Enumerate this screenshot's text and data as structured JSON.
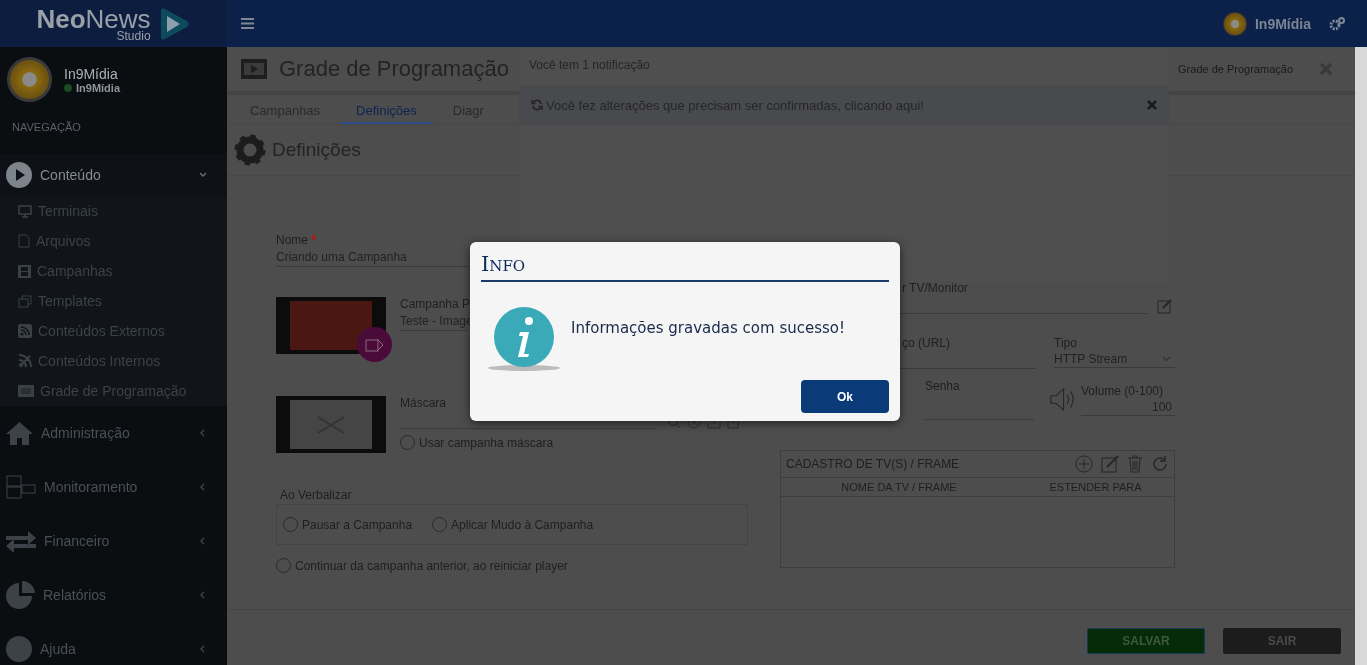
{
  "brand": {
    "name": "**Neo**News",
    "sub": "Studio"
  },
  "topbar": {
    "user": "In9Mídia"
  },
  "profile": {
    "name": "In9Mídia",
    "status": "In9Mídia",
    "online": true
  },
  "nav_header": "NAVEGAÇÃO",
  "nav": [
    {
      "label": "Conteúdo",
      "expanded": true,
      "children": [
        {
          "label": "Terminais"
        },
        {
          "label": "Arquivos"
        },
        {
          "label": "Campanhas"
        },
        {
          "label": "Templates"
        },
        {
          "label": "Conteúdos Externos"
        },
        {
          "label": "Conteúdos Internos"
        },
        {
          "label": "Grade de Programação"
        }
      ]
    },
    {
      "label": "Administração",
      "expanded": false
    },
    {
      "label": "Monitoramento",
      "expanded": false
    },
    {
      "label": "Financeiro",
      "expanded": false
    },
    {
      "label": "Relatórios",
      "expanded": false
    },
    {
      "label": "Ajuda",
      "expanded": false
    }
  ],
  "page": {
    "title": "Grade de Programação",
    "breadcrumb": "Grade de Programação",
    "section": "Definições"
  },
  "tabs": [
    {
      "label": "Campanhas",
      "selected": false
    },
    {
      "label": "Definições",
      "selected": true
    },
    {
      "label": "Diagr",
      "selected": false
    }
  ],
  "notification": {
    "header": "Você tem 1 notificação",
    "message": "Você fez alterações que precisam ser confirmadas, clicando aqui!"
  },
  "form": {
    "name_label": "Nome",
    "name_required_mark": "*",
    "name_value": "Criando uma Campanha",
    "campaign_label": "Campanha P",
    "campaign_value": "Teste - Image",
    "mask_label": "Máscara",
    "use_mask": {
      "label": "Usar campanha máscara",
      "checked": false
    },
    "verbalize": {
      "legend": "Ao Verbalizar",
      "options": [
        {
          "label": "Pausar a Campanha",
          "selected": false
        },
        {
          "label": "Aplicar Mudo à Campanha",
          "selected": false
        }
      ]
    },
    "continue_option": {
      "label": "Continuar da campanha anterior, ao reiniciar player",
      "checked": false
    }
  },
  "right": {
    "schedule_label": "r TV/Monitor",
    "url_label": "ço (URL)",
    "type_label": "Tipo",
    "type_value": "HTTP Stream",
    "password_label": "Senha",
    "volume_label": "Volume (0-100)",
    "volume_value": "100",
    "table": {
      "title": "CADASTRO DE TV(S) / FRAME",
      "columns": [
        "NOME DA TV / FRAME",
        "ESTENDER PARA"
      ]
    }
  },
  "buttons": [
    {
      "label": "SALVAR",
      "kind": "primary"
    },
    {
      "label": "SAIR",
      "kind": "secondary"
    }
  ],
  "dialog": {
    "title": "Info",
    "message": "Informações gravadas com sucesso!",
    "button": "Ok"
  }
}
